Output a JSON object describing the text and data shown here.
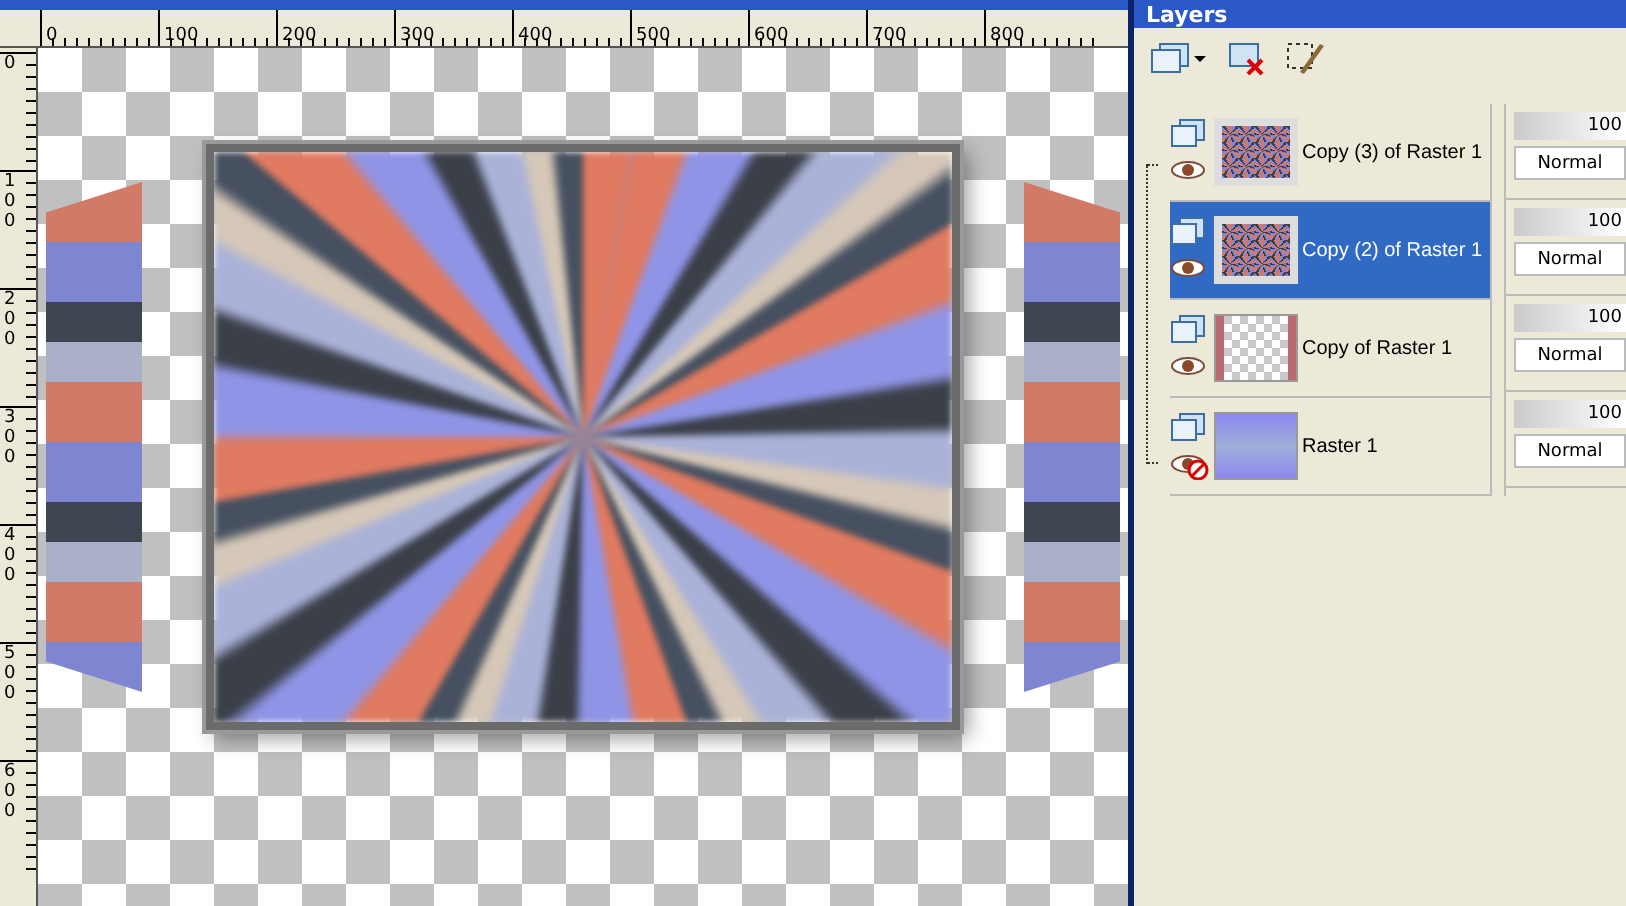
{
  "top_ruler": [
    "0",
    "100",
    "200",
    "300",
    "400",
    "500",
    "600",
    "700",
    "800"
  ],
  "left_ruler": [
    "0",
    "100",
    "200",
    "300",
    "400",
    "500",
    "600"
  ],
  "layers_panel": {
    "title": "Layers",
    "layers": [
      {
        "name": "Copy (3) of Raster 1",
        "selected": false,
        "visible": true,
        "kind": "image",
        "opacity": "100",
        "level": 1,
        "blend_mode": "Normal"
      },
      {
        "name": "Copy (2) of Raster 1",
        "selected": true,
        "visible": true,
        "kind": "image",
        "opacity": "100",
        "level": 1,
        "blend_mode": "Normal"
      },
      {
        "name": "Copy of Raster 1",
        "selected": false,
        "visible": true,
        "kind": "edges",
        "opacity": "100",
        "level": 1,
        "blend_mode": "Normal"
      },
      {
        "name": "Raster 1",
        "selected": false,
        "visible": false,
        "kind": "gradient",
        "opacity": "100",
        "level": 1,
        "blend_mode": "Normal"
      }
    ]
  }
}
